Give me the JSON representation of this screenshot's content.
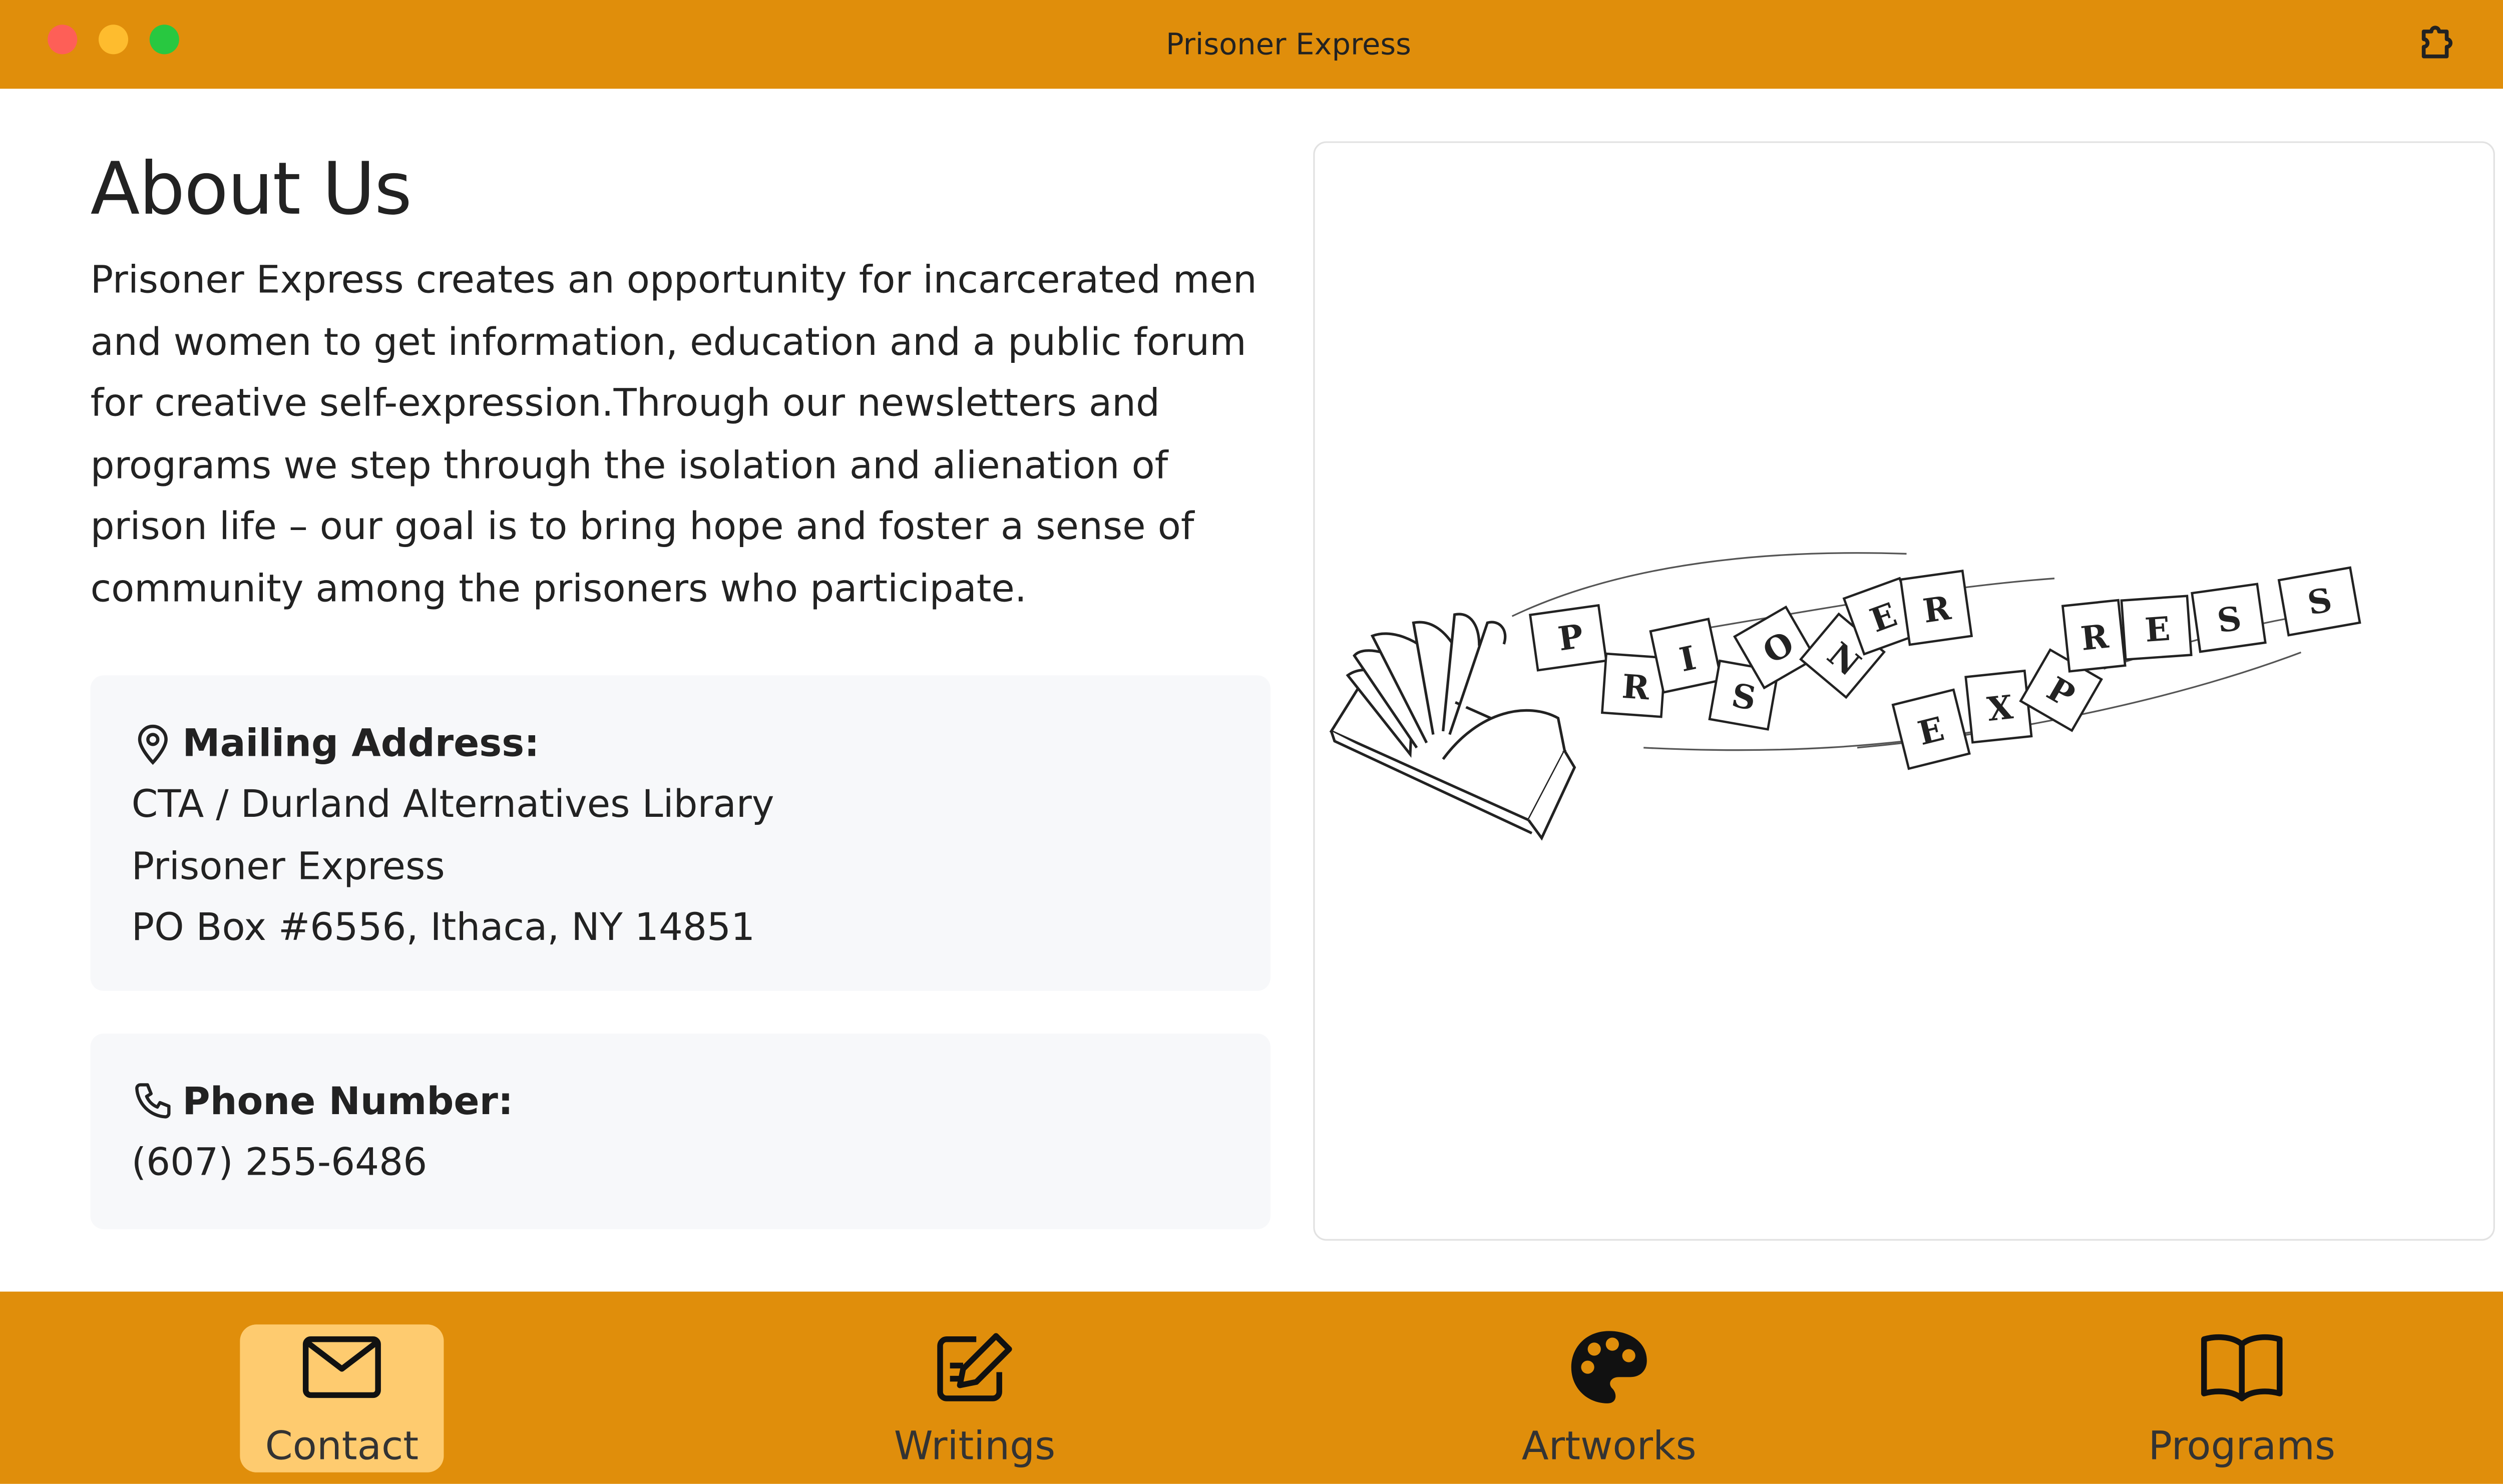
{
  "window": {
    "title": "Prisoner Express"
  },
  "about": {
    "heading": "About Us",
    "description": "Prisoner Express creates an opportunity for incarcerated men and women to get information, education and a public forum for creative self-expression.Through our newsletters and programs we step through the isolation and alienation of prison life – our goal is to bring hope and foster a sense of community among the prisoners who participate."
  },
  "mailing": {
    "title": "Mailing Address:",
    "line1": "CTA / Durland Alternatives Library",
    "line2": "Prisoner Express",
    "line3": "PO Box #6556, Ithaca, NY 14851",
    "icon": "map-pin-icon"
  },
  "phone": {
    "title": "Phone Number:",
    "number": "(607) 255-6486",
    "icon": "phone-icon"
  },
  "logo": {
    "text": "PRISONER EXPRESS"
  },
  "nav": {
    "items": [
      {
        "label": "Contact",
        "icon": "envelope-icon",
        "active": true
      },
      {
        "label": "Writings",
        "icon": "pencil-square-icon",
        "active": false
      },
      {
        "label": "Artworks",
        "icon": "palette-icon",
        "active": false
      },
      {
        "label": "Programs",
        "icon": "book-icon",
        "active": false
      }
    ]
  },
  "colors": {
    "accent": "#e08e0b",
    "active_tab": "#fecb6f",
    "card_bg": "#f7f8fa"
  }
}
